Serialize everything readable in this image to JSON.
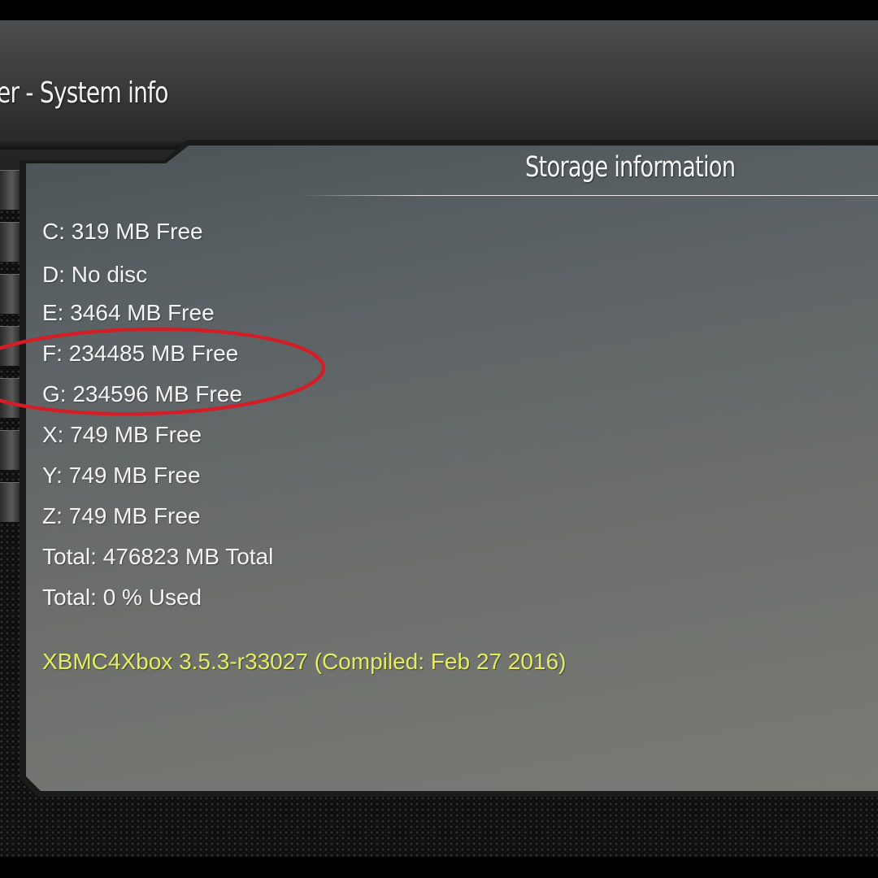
{
  "window": {
    "title": "er - System info"
  },
  "storage": {
    "heading": "Storage information",
    "drives": [
      "C: 319 MB Free",
      "D: No disc",
      "E: 3464 MB Free",
      "F: 234485 MB Free",
      "G: 234596 MB Free",
      "X: 749 MB Free",
      "Y: 749 MB Free",
      "Z: 749 MB Free"
    ],
    "total_size": "Total: 476823 MB Total",
    "total_used": "Total: 0 % Used"
  },
  "version": "XBMC4Xbox 3.5.3-r33027 (Compiled: Feb 27 2016)",
  "colors": {
    "version_text": "#e4ec62",
    "annotation_ellipse": "#d21f27",
    "text": "#f4f4f4"
  },
  "annotation": {
    "type": "red-ellipse",
    "highlights": [
      "F: 234485 MB Free",
      "G: 234596 MB Free"
    ]
  }
}
